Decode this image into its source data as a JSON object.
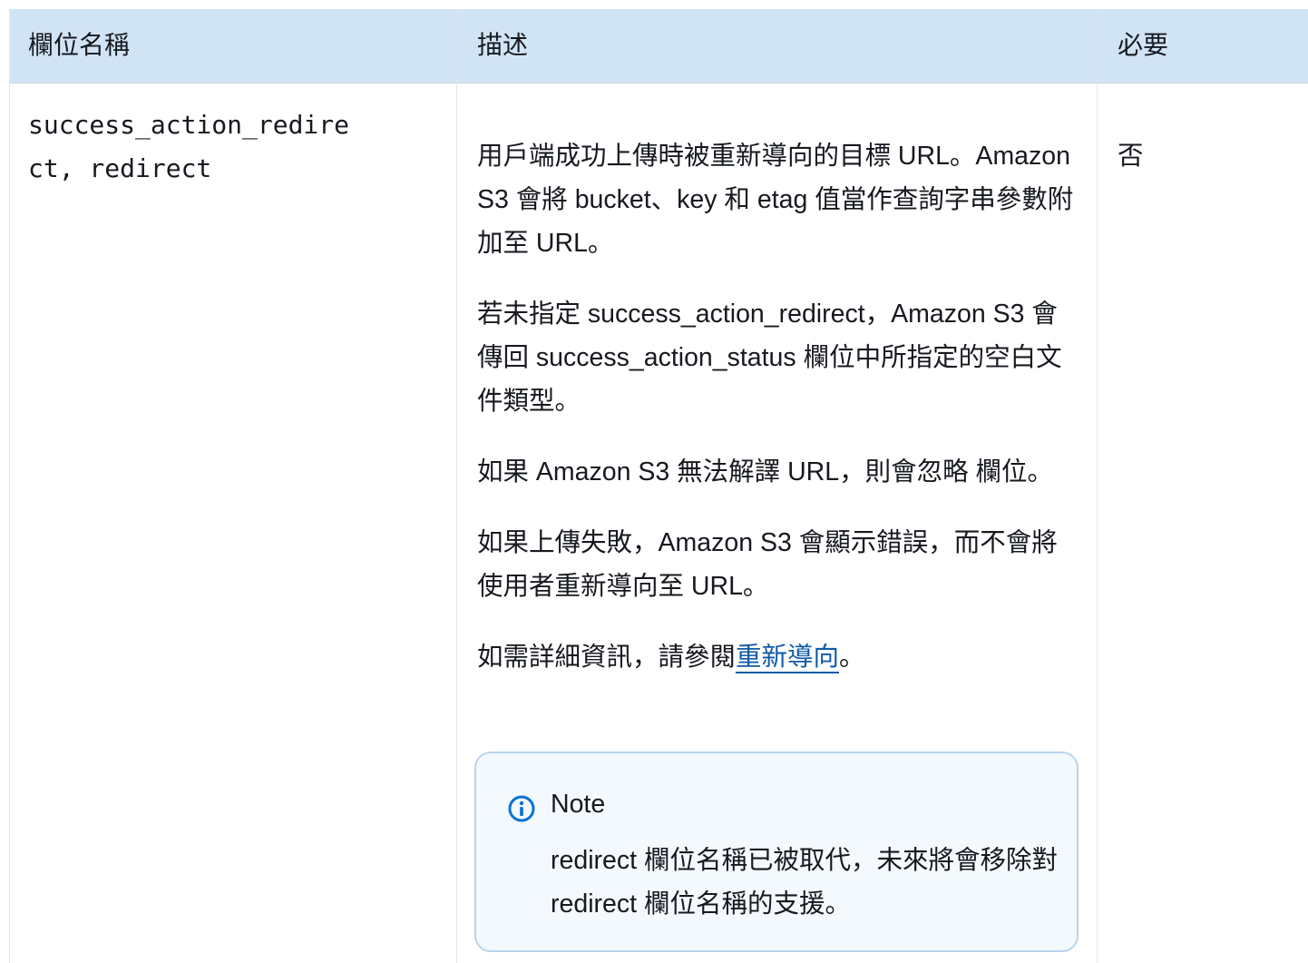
{
  "table": {
    "headers": {
      "field_name": "欄位名稱",
      "description": "描述",
      "required": "必要"
    },
    "row": {
      "field_name": "success_action_redirect, redirect",
      "description": {
        "p1": "用戶端成功上傳時被重新導向的目標 URL。Amazon S3 會將 bucket、key 和 etag 值當作查詢字串參數附加至 URL。",
        "p2": "若未指定 success_action_redirect，Amazon S3 會傳回 success_action_status 欄位中所指定的空白文件類型。",
        "p3": "如果 Amazon S3 無法解譯 URL，則會忽略 欄位。",
        "p4": "如果上傳失敗，Amazon S3 會顯示錯誤，而不會將使用者重新導向至 URL。",
        "p5_prefix": "如需詳細資訊，請參閱",
        "p5_link": "重新導向",
        "p5_suffix": "。"
      },
      "required": "否",
      "note": {
        "icon": "info-icon",
        "title": "Note",
        "body": "redirect 欄位名稱已被取代，未來將會移除對 redirect 欄位名稱的支援。"
      }
    }
  },
  "colors": {
    "header_bg": "#d1e4f5",
    "link": "#0f5aa8",
    "note_border": "#b8d4ed",
    "note_bg": "#f4f9fd",
    "info_icon": "#0972d3"
  }
}
